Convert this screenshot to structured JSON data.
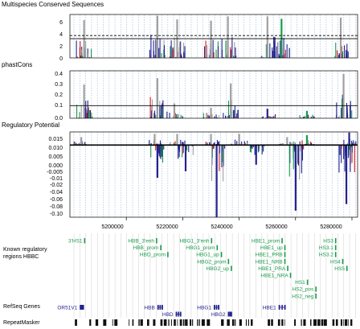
{
  "tracks": {
    "msc": {
      "title": "Multispecies Conserved Sequences",
      "yticks": [
        "0",
        "2",
        "4",
        "6"
      ]
    },
    "phastcons": {
      "title": "phastCons",
      "yticks": [
        "0.0",
        "0.1",
        "0.2",
        "0.3",
        "0.4"
      ]
    },
    "regpot": {
      "title": "Regulatory Potential",
      "yticks": [
        "0.015",
        "0.010",
        "0.005",
        "0.000",
        "-0.005",
        "-0.01",
        "-0.02",
        "-0.04",
        "-0.06",
        "-0.08",
        "-0.10"
      ]
    },
    "known_reg": {
      "title_line1": "Known regulatory",
      "title_line2": "regions HBBC"
    },
    "refseq": {
      "title": "RefSeq Genes"
    },
    "repeatmasker": {
      "title": "RepeatMasker"
    }
  },
  "xaxis": {
    "ticks": [
      "5200000",
      "5220000",
      "5240000",
      "5260000",
      "5280000"
    ]
  },
  "known_regulatory_regions": [
    {
      "label": "3'HS1",
      "pos": 5185000,
      "row": 0
    },
    {
      "label": "HBB_3'enh",
      "pos": 5210500,
      "row": 0
    },
    {
      "label": "HBB_prom",
      "pos": 5212000,
      "row": 1
    },
    {
      "label": "HBD_prom",
      "pos": 5214500,
      "row": 2
    },
    {
      "label": "HBG1_3'enh",
      "pos": 5230000,
      "row": 0
    },
    {
      "label": "HBG1_prom",
      "pos": 5232000,
      "row": 1
    },
    {
      "label": "HBG1_up",
      "pos": 5233500,
      "row": 2
    },
    {
      "label": "HBG2_prom",
      "pos": 5236000,
      "row": 3
    },
    {
      "label": "HBG2_up",
      "pos": 5237000,
      "row": 4
    },
    {
      "label": "HBE1_prom",
      "pos": 5255000,
      "row": 0
    },
    {
      "label": "HBE1_up",
      "pos": 5256000,
      "row": 1
    },
    {
      "label": "HBE1_PRB",
      "pos": 5256000,
      "row": 2
    },
    {
      "label": "HBE1_NRB",
      "pos": 5256000,
      "row": 3
    },
    {
      "label": "HBE1_PRA",
      "pos": 5257000,
      "row": 4
    },
    {
      "label": "HBE1_NRA",
      "pos": 5258000,
      "row": 5
    },
    {
      "label": "HS3",
      "pos": 5274000,
      "row": 0
    },
    {
      "label": "HS3.1",
      "pos": 5274000,
      "row": 1
    },
    {
      "label": "HS3.2",
      "pos": 5274000,
      "row": 2
    },
    {
      "label": "HS4",
      "pos": 5276500,
      "row": 3
    },
    {
      "label": "HS5",
      "pos": 5278000,
      "row": 4
    },
    {
      "label": "HS1",
      "pos": 5264000,
      "row": 6
    },
    {
      "label": "HS2_pos",
      "pos": 5267000,
      "row": 7
    },
    {
      "label": "HS2_neg",
      "pos": 5267000,
      "row": 8
    }
  ],
  "refseq_genes": [
    {
      "label": "OR51V1",
      "start": 5183500,
      "end": 5185000,
      "row": 0,
      "exon": true
    },
    {
      "label": "HBB",
      "start": 5211000,
      "end": 5213000,
      "row": 0
    },
    {
      "label": "HBD",
      "start": 5217500,
      "end": 5219500,
      "row": 1
    },
    {
      "label": "HBG1",
      "start": 5231000,
      "end": 5233000,
      "row": 0
    },
    {
      "label": "HBG2",
      "start": 5236000,
      "end": 5237500,
      "row": 1
    },
    {
      "label": "HBE1",
      "start": 5254000,
      "end": 5256500,
      "row": 0
    }
  ],
  "chart_data": [
    {
      "type": "bar",
      "title": "Multispecies Conserved Sequences",
      "xlim": [
        5180000,
        5282000
      ],
      "ylim": [
        0,
        7
      ],
      "reference_lines": [
        3.1,
        3.6
      ],
      "peaks": [
        {
          "x": 5185000,
          "y": 6.1,
          "color": "gray"
        },
        {
          "x": 5211000,
          "y": 6.8,
          "color": "gray"
        },
        {
          "x": 5218000,
          "y": 6.2,
          "color": "gray"
        },
        {
          "x": 5230000,
          "y": 6.0,
          "color": "gray"
        },
        {
          "x": 5236000,
          "y": 6.7,
          "color": "gray"
        },
        {
          "x": 5250000,
          "y": 6.7,
          "color": "gray"
        },
        {
          "x": 5255000,
          "y": 6.3,
          "color": "green"
        },
        {
          "x": 5276000,
          "y": 6.5,
          "color": "gray"
        }
      ]
    },
    {
      "type": "bar",
      "title": "phastCons",
      "xlim": [
        5180000,
        5282000
      ],
      "ylim": [
        0,
        0.45
      ],
      "reference_lines": [
        0.12
      ],
      "peaks": [
        {
          "x": 5185000,
          "y": 0.32,
          "color": "gray"
        },
        {
          "x": 5211000,
          "y": 0.38,
          "color": "gray"
        },
        {
          "x": 5217000,
          "y": 0.14,
          "color": "gray"
        },
        {
          "x": 5230000,
          "y": 0.1,
          "color": "gray"
        },
        {
          "x": 5237000,
          "y": 0.33,
          "color": "gray"
        },
        {
          "x": 5250000,
          "y": 0.09,
          "color": "navy"
        },
        {
          "x": 5264000,
          "y": 0.07,
          "color": "green"
        },
        {
          "x": 5277000,
          "y": 0.42,
          "color": "gray"
        }
      ]
    },
    {
      "type": "bar",
      "title": "Regulatory Potential",
      "xlim": [
        5180000,
        5282000
      ],
      "ylim": [
        -0.11,
        0.02
      ],
      "reference_lines": [
        0.0
      ],
      "peaks": [
        {
          "x": 5184000,
          "y": 0.012,
          "color": "gray"
        },
        {
          "x": 5210000,
          "y": 0.017,
          "color": "gray"
        },
        {
          "x": 5211000,
          "y": -0.05,
          "color": "navy"
        },
        {
          "x": 5218000,
          "y": 0.017,
          "color": "gray"
        },
        {
          "x": 5221000,
          "y": -0.04,
          "color": "navy"
        },
        {
          "x": 5230000,
          "y": 0.017,
          "color": "gray"
        },
        {
          "x": 5232000,
          "y": -0.11,
          "color": "navy"
        },
        {
          "x": 5240000,
          "y": 0.017,
          "color": "gray"
        },
        {
          "x": 5246000,
          "y": -0.03,
          "color": "navy"
        },
        {
          "x": 5257000,
          "y": 0.012,
          "color": "gray"
        },
        {
          "x": 5260000,
          "y": -0.1,
          "color": "navy"
        },
        {
          "x": 5264000,
          "y": 0.015,
          "color": "green"
        },
        {
          "x": 5278000,
          "y": -0.09,
          "color": "navy"
        },
        {
          "x": 5279000,
          "y": 0.019,
          "color": "navy"
        }
      ]
    }
  ],
  "colors": {
    "gray": "#a0a0a0",
    "navy": "#23238e",
    "green": "#1a9a4a",
    "red": "#d11a1a",
    "gridline": "#9ab7d8",
    "frame": "#000000",
    "regulatory_text": "#1a9a4a",
    "gene_text": "#23238e",
    "repeat": "#111111"
  }
}
